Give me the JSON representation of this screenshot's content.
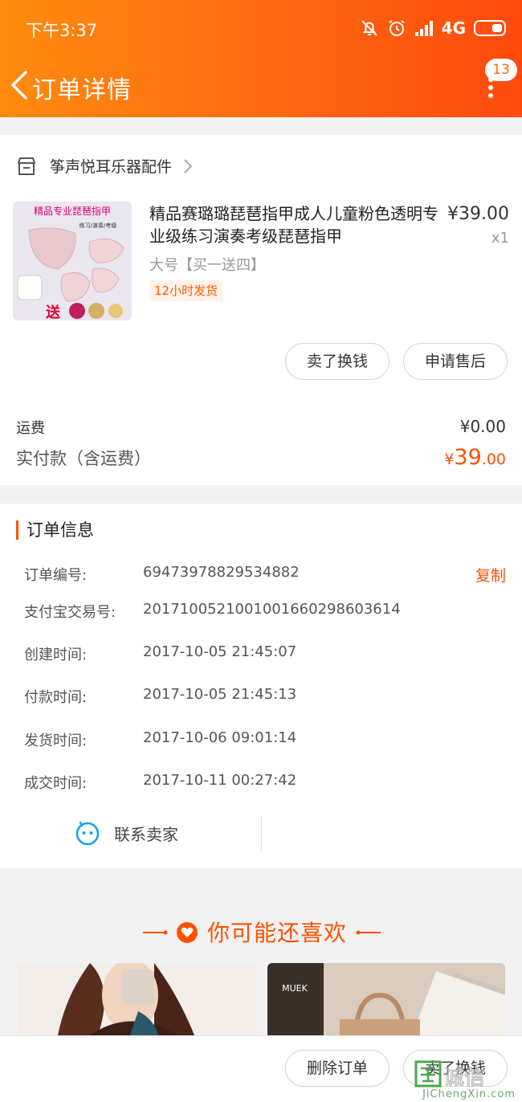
{
  "status_bar": {
    "time": "下午3:37",
    "network": "4G"
  },
  "header": {
    "title": "订单详情",
    "badge_count": "13"
  },
  "shop": {
    "name": "筝声悦耳乐器配件"
  },
  "product": {
    "name": "精品赛璐璐琵琶指甲成人儿童粉色透明专业级练习演奏考级琵琶指甲",
    "price": "¥39.00",
    "quantity": "x1",
    "sku": "大号【买一送四】",
    "shipping_tag": "12小时发货",
    "thumb_title": "精品专业琵琶指甲",
    "thumb_sub": "练习/演奏/考级",
    "thumb_gift": "送"
  },
  "actions": {
    "sell_label": "卖了换钱",
    "aftersale_label": "申请售后"
  },
  "fees": {
    "shipping_label": "运费",
    "shipping_value": "¥0.00",
    "paid_label": "实付款（含运费）",
    "paid_currency": "¥",
    "paid_int": "39",
    "paid_dec": ".00"
  },
  "order_info": {
    "title": "订单信息",
    "copy_label": "复制",
    "rows": [
      {
        "label": "订单编号:",
        "value": "69473978829534882"
      },
      {
        "label": "支付宝交易号:",
        "value": "2017100521001001660298603614"
      },
      {
        "label": "创建时间:",
        "value": "2017-10-05 21:45:07"
      },
      {
        "label": "付款时间:",
        "value": "2017-10-05 21:45:13"
      },
      {
        "label": "发货时间:",
        "value": "2017-10-06 09:01:14"
      },
      {
        "label": "成交时间:",
        "value": "2017-10-11 00:27:42"
      }
    ]
  },
  "contact": {
    "label": "联系卖家"
  },
  "recommend": {
    "title": "你可能还喜欢",
    "brand_text": "MUEK"
  },
  "bottom": {
    "delete_label": "删除订单",
    "sell_label": "卖了换钱"
  },
  "watermark": {
    "text": "JiChengXin.com",
    "glyphs": "诚信"
  },
  "colors": {
    "accent": "#ff5000",
    "header_start": "#ff8b0f",
    "header_end": "#ff4a0e"
  }
}
